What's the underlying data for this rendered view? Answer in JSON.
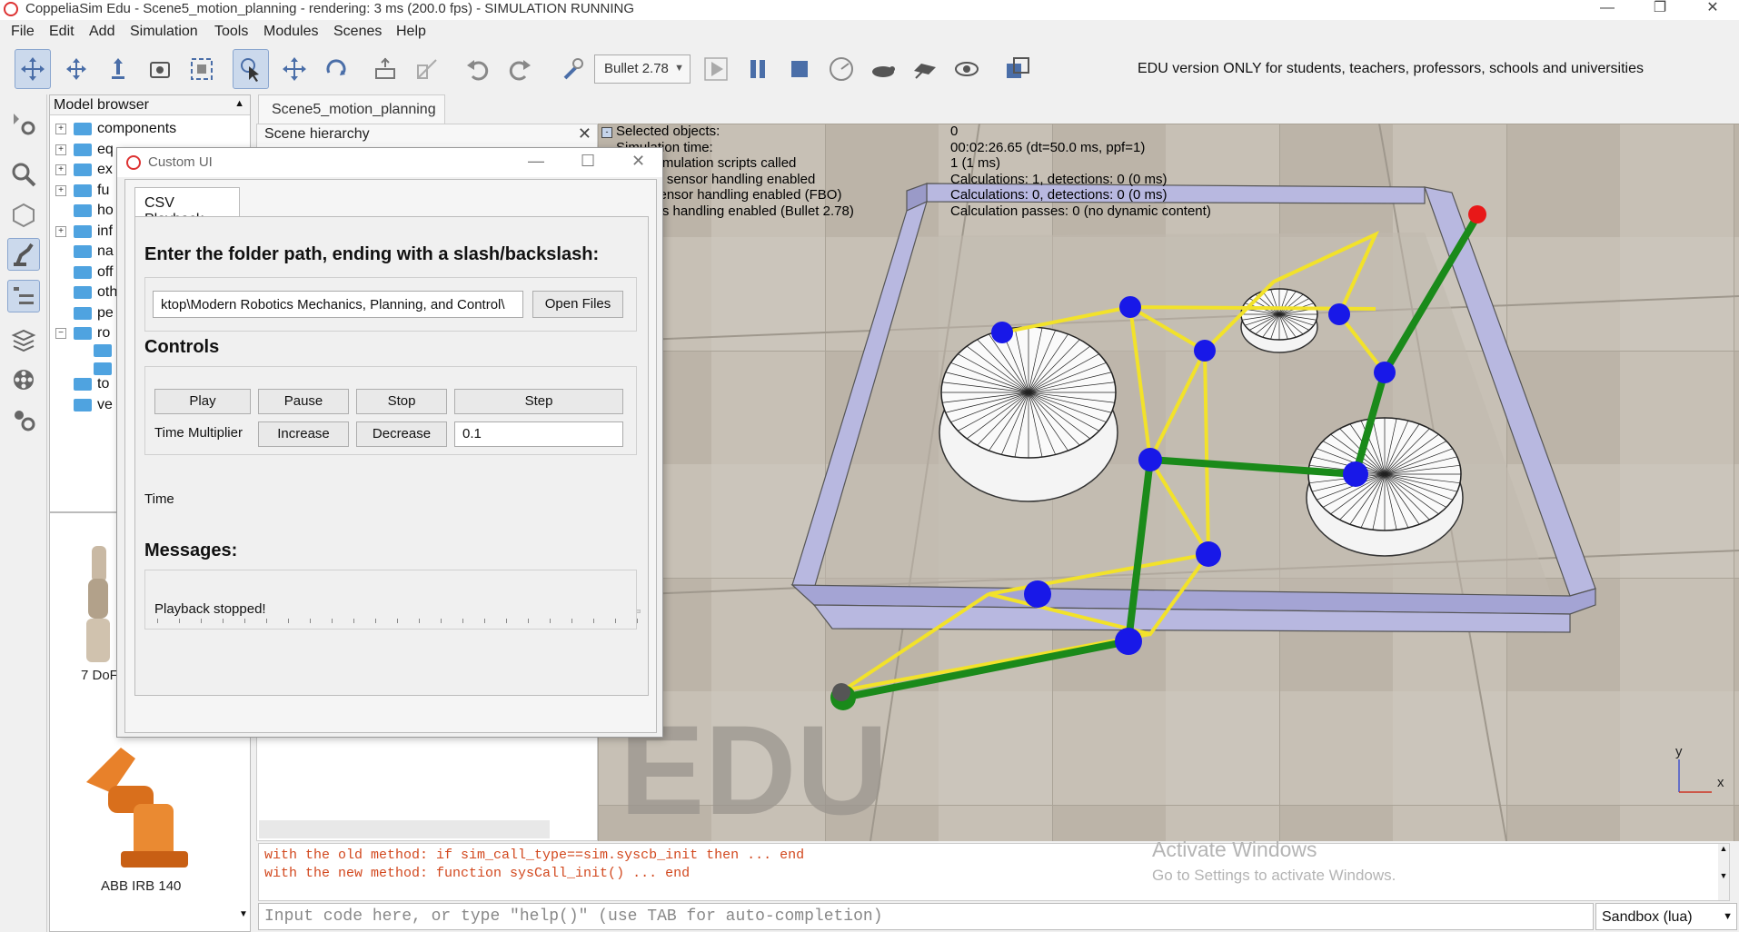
{
  "window": {
    "title": "CoppeliaSim Edu - Scene5_motion_planning - rendering: 3 ms (200.0 fps) - SIMULATION RUNNING",
    "minimize": "—",
    "maximize": "❐",
    "close": "✕"
  },
  "menubar": [
    "File",
    "Edit",
    "Add",
    "Simulation",
    "Tools",
    "Modules",
    "Scenes",
    "Help"
  ],
  "toolbar": {
    "engine": "Bullet 2.78",
    "edu_note": "EDU version ONLY for students, teachers, professors, schools and universities"
  },
  "model_browser": {
    "title": "Model browser",
    "items": [
      {
        "label": "components",
        "expandable": true
      },
      {
        "label": "eq",
        "expandable": true
      },
      {
        "label": "ex",
        "expandable": true
      },
      {
        "label": "fu",
        "expandable": true
      },
      {
        "label": "ho",
        "expandable": false
      },
      {
        "label": "inf",
        "expandable": true
      },
      {
        "label": "na",
        "expandable": false
      },
      {
        "label": "off",
        "expandable": false
      },
      {
        "label": "oth",
        "expandable": false
      },
      {
        "label": "pe",
        "expandable": false
      },
      {
        "label": "ro",
        "expandable": true
      },
      {
        "label": "to",
        "expandable": false
      },
      {
        "label": "ve",
        "expandable": false
      }
    ],
    "thumbs": [
      "7 DoF",
      "ABB IRB 140"
    ]
  },
  "scene": {
    "tab": "Scene5_motion_planning",
    "hierarchy_title": "Scene hierarchy",
    "info_left": [
      "Selected objects:",
      "Simulation time:",
      "simulation scripts called",
      "ty sensor handling enabled",
      "sensor handling enabled (FBO)",
      "ics handling enabled (Bullet 2.78)"
    ],
    "info_right": [
      "0",
      "00:02:26.65 (dt=50.0 ms, ppf=1)",
      "1 (1 ms)",
      "Calculations: 1, detections: 0 (0 ms)",
      "Calculations: 0, detections: 0 (0 ms)",
      "Calculation passes: 0 (no dynamic content)"
    ],
    "watermark": "EDU",
    "axis_x": "x",
    "axis_y": "y"
  },
  "dialog": {
    "title": "Custom UI",
    "tab": "CSV Playback",
    "folder_prompt": "Enter the folder path, ending with a slash/backslash:",
    "folder_value": "ktop\\Modern Robotics Mechanics, Planning, and Control\\",
    "open_files": "Open Files",
    "controls_title": "Controls",
    "play": "Play",
    "pause": "Pause",
    "stop": "Stop",
    "step": "Step",
    "time_multiplier": "Time Multiplier",
    "increase": "Increase",
    "decrease": "Decrease",
    "multiplier_value": "0.1",
    "time_label": "Time",
    "time_slider_position": 0,
    "messages_title": "Messages:",
    "message": "Playback stopped!"
  },
  "console": {
    "lines": [
      "with the old method: if sim_call_type==sim.syscb_init then ... end",
      "with the new method: function sysCall_init() ... end"
    ],
    "input_placeholder": "Input code here, or type \"help()\" (use TAB for auto-completion)",
    "sandbox": "Sandbox (lua)"
  },
  "activation": {
    "title": "Activate Windows",
    "subtitle": "Go to Settings to activate Windows."
  },
  "colors": {
    "accent_active": "#cbd9ec",
    "path_green": "#1a8a1a",
    "edge_yellow": "#f2e22a",
    "node_blue": "#1818e8",
    "goal_red": "#e81818",
    "wall": "#b8b8e0"
  }
}
